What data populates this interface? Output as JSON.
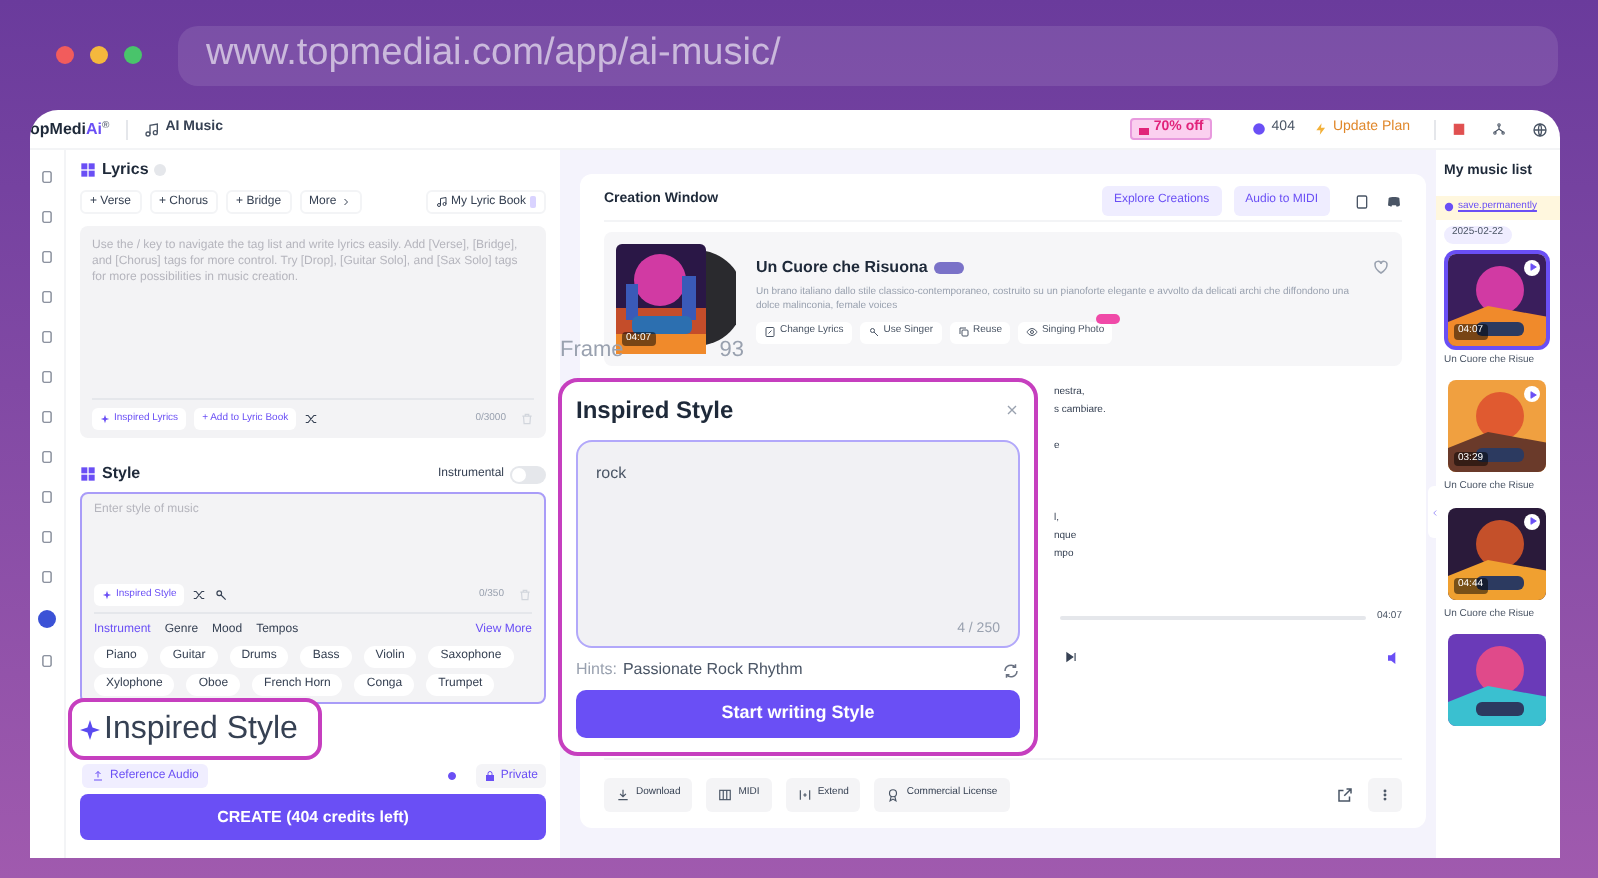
{
  "browser": {
    "url": "www.topmediai.com/app/ai-music/"
  },
  "header": {
    "logo": "opMedi",
    "logo_accent": "Ai",
    "logo_mark": "®",
    "app": "AI Music",
    "promo": "70% off",
    "credits": "404",
    "upgrade": "Update Plan"
  },
  "lyrics": {
    "title": "Lyrics",
    "chips": [
      "+ Verse",
      "+ Chorus",
      "+ Bridge",
      "More"
    ],
    "lyric_book": "My Lyric Book",
    "placeholder": "Use the / key to navigate the tag list and write lyrics easily. Add [Verse], [Bridge], and [Chorus] tags for more control. Try [Drop], [Guitar Solo], and [Sax Solo] tags for more possibilities in music creation.",
    "actions": [
      "Inspired Lyrics",
      "+ Add to Lyric Book"
    ],
    "counter": "0/3000"
  },
  "style": {
    "title": "Style",
    "instrumental_label": "Instrumental",
    "instrumental_on": false,
    "placeholder": "Enter style of music",
    "inspired": "Inspired Style",
    "counter": "0/350",
    "tabs": [
      {
        "label": "Instrument",
        "selected": true
      },
      {
        "label": "Genre",
        "selected": false
      },
      {
        "label": "Mood",
        "selected": false
      },
      {
        "label": "Tempos",
        "selected": false
      }
    ],
    "view_more": "View More",
    "chips": [
      "Piano",
      "Guitar",
      "Drums",
      "Bass",
      "Violin",
      "Saxophone",
      "Xylophone",
      "Oboe",
      "French Horn",
      "Conga",
      "Trumpet"
    ]
  },
  "reference_audio": "Reference Audio",
  "privacy": "Private",
  "create": "CREATE (404 credits left)",
  "creation": {
    "title": "Creation Window",
    "buttons": [
      "Explore Creations",
      "Audio to MIDI"
    ],
    "song": {
      "title": "Un Cuore che Risuona",
      "duration": "04:07",
      "description": "Un brano italiano dallo stile classico-contemporaneo, costruito su un pianoforte elegante e avvolto da delicati archi che diffondono una dolce malinconia, female voices",
      "actions": [
        "Change Lyrics",
        "Use Singer",
        "Reuse",
        "Singing Photo"
      ]
    },
    "lyric_fragments": [
      "nestra,",
      "s cambiare.",
      "e",
      "l,",
      "nque",
      "mpo"
    ],
    "player": {
      "total": "04:07"
    },
    "footer": [
      "Download",
      "MIDI",
      "Extend",
      "Commercial License"
    ]
  },
  "music_list": {
    "title": "My music list",
    "notice": "save.permanently",
    "date": "2025-02-22",
    "items": [
      {
        "title": "Un Cuore che Risue",
        "duration": "04:07",
        "selected": true
      },
      {
        "title": "Un Cuore che Risue",
        "duration": "03:29",
        "selected": false
      },
      {
        "title": "Un Cuore che Risue",
        "duration": "04:44",
        "selected": false
      },
      {
        "selected": false
      }
    ]
  },
  "frame_label": [
    "Frame",
    "93"
  ],
  "popup": {
    "title": "Inspired Style",
    "value": "rock",
    "counter": "4 / 250",
    "hint_label": "Hints:",
    "hint": "Passionate Rock Rhythm",
    "button": "Start writing Style"
  },
  "callout": {
    "label": "Inspired Style"
  }
}
